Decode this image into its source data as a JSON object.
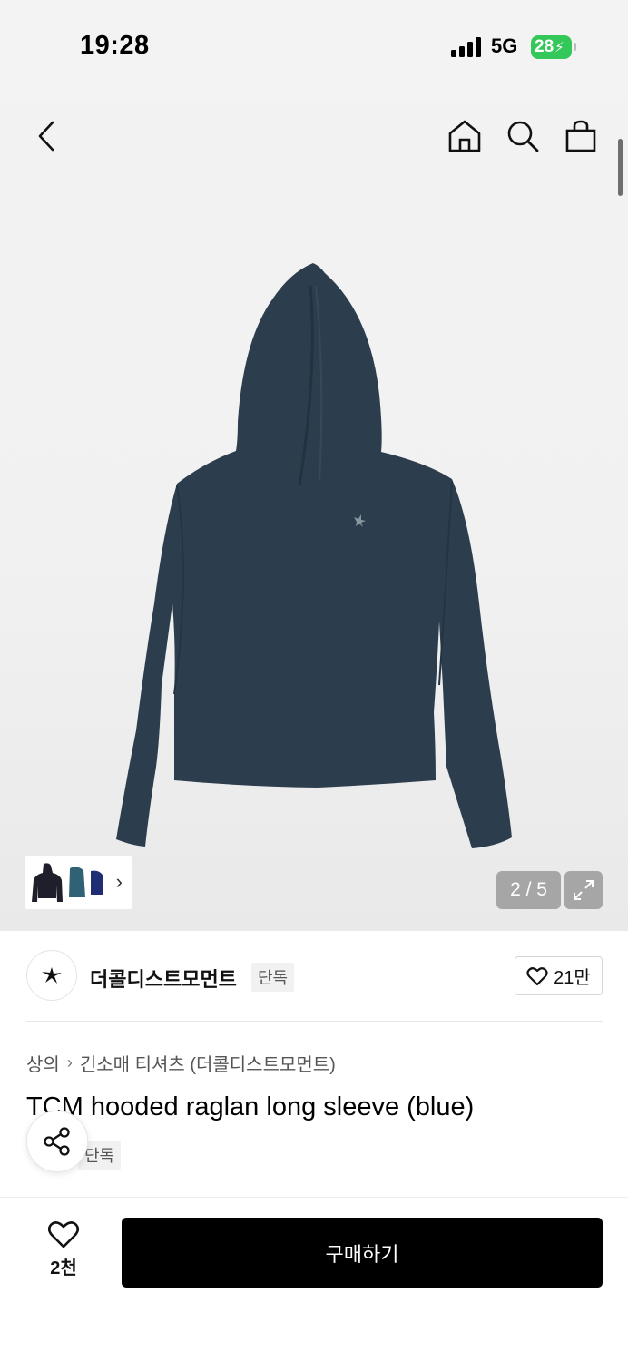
{
  "status_bar": {
    "time": "19:28",
    "network": "5G",
    "battery": "28"
  },
  "nav": {
    "back_icon": "chevron-left-icon",
    "home_icon": "home-icon",
    "search_icon": "search-icon",
    "cart_icon": "shopping-bag-icon"
  },
  "gallery": {
    "counter": "2 / 5",
    "expand_icon": "expand-icon",
    "thumbnail_more_icon": "chevron-right-icon",
    "product_color": "#2c3e4e"
  },
  "brand": {
    "name": "더콜디스트모먼트",
    "tag": "단독",
    "likes": "21만"
  },
  "breadcrumb": {
    "category": "상의",
    "subcategory": "긴소매 티셔츠 (더콜디스트모먼트)"
  },
  "product": {
    "title": "TCM hooded raglan long sleeve (blue)",
    "tag": "단독"
  },
  "bottom_bar": {
    "wish_count": "2천",
    "buy_label": "구매하기"
  }
}
